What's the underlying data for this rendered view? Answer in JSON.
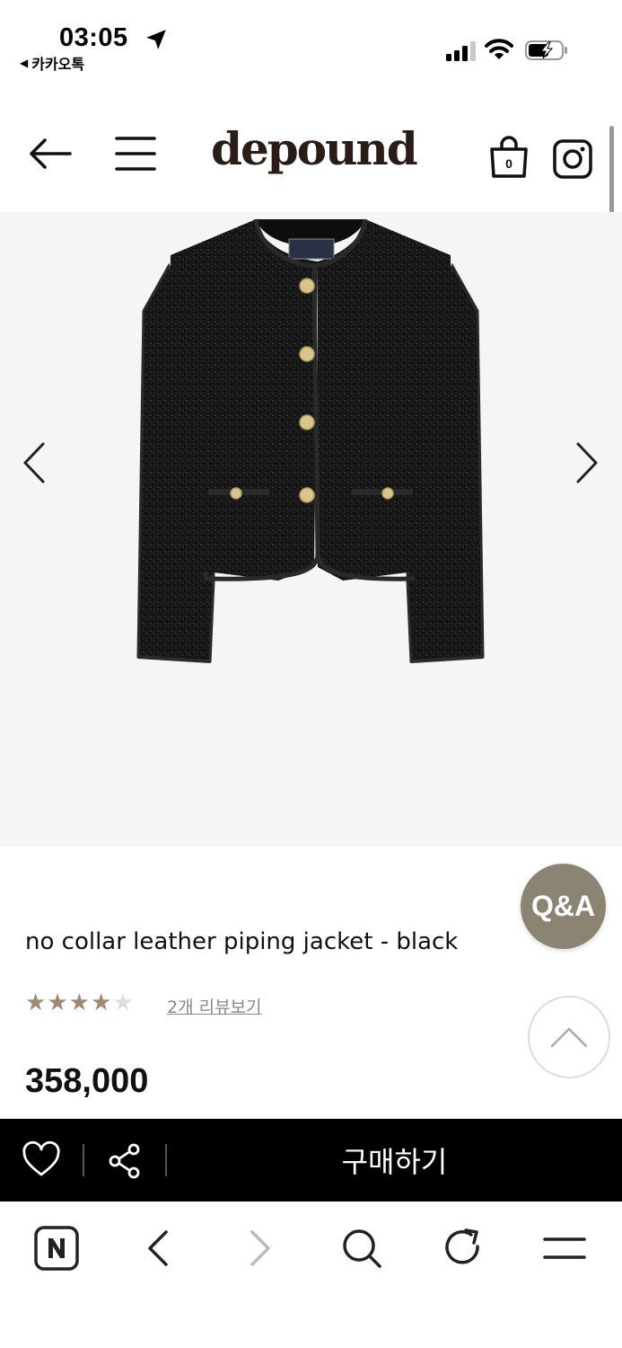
{
  "status_bar": {
    "time": "03:05",
    "back_app": "카카오톡",
    "icons": [
      "location-arrow-icon",
      "signal-icon",
      "wifi-icon",
      "battery-charging-icon"
    ]
  },
  "header": {
    "logo": "depound",
    "cart_count": "0",
    "icons": [
      "back-arrow-icon",
      "hamburger-menu-icon",
      "shopping-bag-icon",
      "instagram-icon"
    ]
  },
  "gallery": {
    "image_subject": "black tweed jacket",
    "prev_icon": "chevron-left-icon",
    "next_icon": "chevron-right-icon"
  },
  "product": {
    "name": "no collar leather piping jacket - black",
    "rating": 4,
    "rating_max": 5,
    "review_link": "2개 리뷰보기",
    "price": "358,000"
  },
  "floating": {
    "qa_label": "Q&A",
    "to_top_icon": "chevron-up-icon"
  },
  "buy_bar": {
    "buy_label": "구매하기",
    "icons": [
      "heart-icon",
      "share-icon"
    ]
  },
  "browser_bar": {
    "icons": [
      "naver-n-icon",
      "back-chevron-icon",
      "forward-chevron-icon",
      "search-icon",
      "reload-icon",
      "menu-icon"
    ]
  },
  "colors": {
    "accent": "#8b8473",
    "star_on": "#a08a6c",
    "star_off": "#dddddd",
    "buy_bar": "#000000",
    "gallery_bg": "#f5f5f5"
  }
}
